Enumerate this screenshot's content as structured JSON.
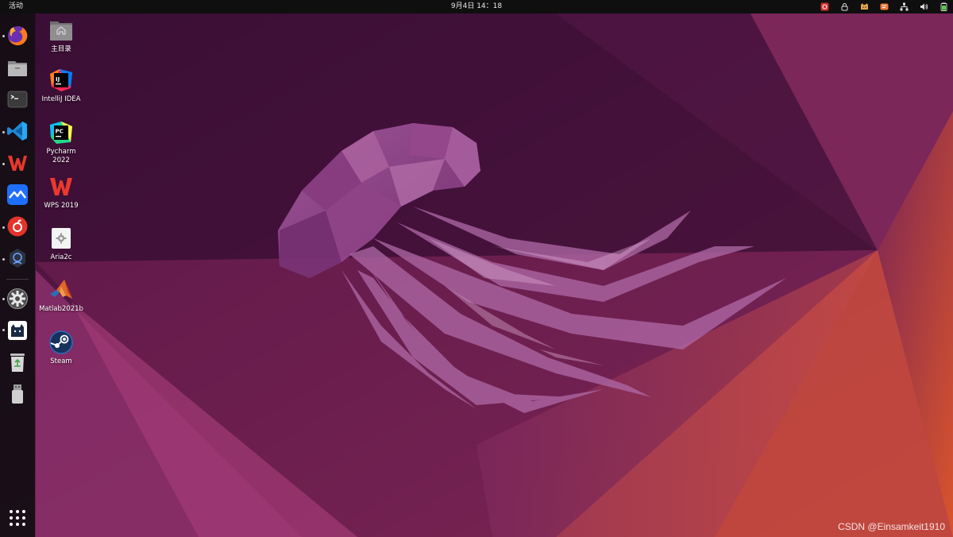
{
  "topbar": {
    "activities_label": "活动",
    "clock": "9月4日  14：18",
    "tray_icons": [
      "app-indicator-red-icon",
      "lock-icon",
      "cat-icon",
      "orange-app-icon",
      "network-icon",
      "volume-icon",
      "battery-icon"
    ]
  },
  "dock": {
    "items": [
      {
        "name": "firefox",
        "icon": "firefox-icon",
        "running": true
      },
      {
        "name": "files",
        "icon": "files-icon",
        "running": false
      },
      {
        "name": "terminal",
        "icon": "terminal-icon",
        "running": false
      },
      {
        "name": "vscode",
        "icon": "vscode-icon",
        "running": true
      },
      {
        "name": "wps",
        "icon": "wps-icon",
        "running": true
      },
      {
        "name": "lark",
        "icon": "lark-icon",
        "running": false
      },
      {
        "name": "netease-music",
        "icon": "netease-music-icon",
        "running": true
      },
      {
        "name": "clash",
        "icon": "clash-icon",
        "running": true
      },
      {
        "name": "settings",
        "icon": "settings-icon",
        "running": true
      },
      {
        "name": "clash-verge",
        "icon": "cat-app-icon",
        "running": true
      },
      {
        "name": "trash",
        "icon": "trash-icon",
        "running": false
      },
      {
        "name": "usb-drive",
        "icon": "usb-drive-icon",
        "running": false
      }
    ],
    "show_apps_icon": "app-grid-icon"
  },
  "desktop": {
    "icons": [
      {
        "label": "主目录",
        "icon": "home-folder-icon"
      },
      {
        "label": "IntelliJ IDEA",
        "icon": "intellij-icon"
      },
      {
        "label": "Pycharm\n2022",
        "icon": "pycharm-icon"
      },
      {
        "label": "WPS 2019",
        "icon": "wps-icon"
      },
      {
        "label": "Aria2c",
        "icon": "gear-file-icon"
      },
      {
        "label": "Matlab2021b",
        "icon": "matlab-icon"
      },
      {
        "label": "Steam",
        "icon": "steam-icon"
      }
    ]
  },
  "watermark": "CSDN @Einsamkeit1910",
  "colors": {
    "topbar": "#0f0f0f",
    "dock": "#140e14",
    "wallpaper_dark": "#3a0f33",
    "wallpaper_mid": "#7a2d62",
    "wallpaper_orange": "#d1522e",
    "jellyfish": "#9b4a8f"
  }
}
